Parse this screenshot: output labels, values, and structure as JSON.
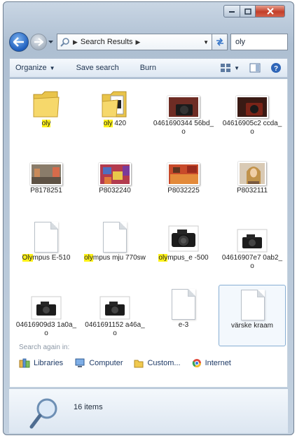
{
  "window": {
    "address_crumb": "Search Results",
    "search_query": "oly",
    "accent": "#2a6fd0"
  },
  "toolbar": {
    "organize": "Organize",
    "save_search": "Save search",
    "burn": "Burn"
  },
  "items": [
    {
      "id": "oly",
      "kind": "folder",
      "label_parts": [
        {
          "t": "oly",
          "h": true
        }
      ]
    },
    {
      "id": "oly420",
      "kind": "folder-photo",
      "label_parts": [
        {
          "t": "oly",
          "h": true
        },
        {
          "t": " 420",
          "h": false
        }
      ]
    },
    {
      "id": "p1",
      "kind": "photo-camera-dark",
      "label_parts": [
        {
          "t": "0461690344 56bd_o",
          "h": false
        }
      ]
    },
    {
      "id": "p2",
      "kind": "photo-camera-red",
      "label_parts": [
        {
          "t": "04616905c2 ccda_o",
          "h": false
        }
      ]
    },
    {
      "id": "p3",
      "kind": "photo-street",
      "label_parts": [
        {
          "t": "P8178251",
          "h": false
        }
      ]
    },
    {
      "id": "p4",
      "kind": "photo-fabric",
      "label_parts": [
        {
          "t": "P8032240",
          "h": false
        }
      ]
    },
    {
      "id": "p5",
      "kind": "photo-market",
      "label_parts": [
        {
          "t": "P8032225",
          "h": false
        }
      ]
    },
    {
      "id": "p6",
      "kind": "photo-woman",
      "label_parts": [
        {
          "t": "P8032111",
          "h": false
        }
      ]
    },
    {
      "id": "d1",
      "kind": "document",
      "label_parts": [
        {
          "t": "Oly",
          "h": true
        },
        {
          "t": "mpus E-510",
          "h": false
        }
      ]
    },
    {
      "id": "d2",
      "kind": "document",
      "label_parts": [
        {
          "t": "oly",
          "h": true
        },
        {
          "t": "mpus mju 770sw",
          "h": false
        }
      ]
    },
    {
      "id": "c1",
      "kind": "camera-big",
      "label_parts": [
        {
          "t": "oly",
          "h": true
        },
        {
          "t": "mpus_e -500",
          "h": false
        }
      ]
    },
    {
      "id": "c2",
      "kind": "camera-small",
      "label_parts": [
        {
          "t": "04616907e7 0ab2_o",
          "h": false
        }
      ]
    },
    {
      "id": "c3",
      "kind": "camera-small",
      "label_parts": [
        {
          "t": "04616909d3 1a0a_o",
          "h": false
        }
      ]
    },
    {
      "id": "c4",
      "kind": "camera-small",
      "label_parts": [
        {
          "t": "0461691152 a46a_o",
          "h": false
        }
      ]
    },
    {
      "id": "d3",
      "kind": "document",
      "label_parts": [
        {
          "t": "e-3",
          "h": false
        }
      ]
    },
    {
      "id": "d4",
      "kind": "document",
      "selected": true,
      "label_parts": [
        {
          "t": "värske kraam",
          "h": false
        }
      ]
    }
  ],
  "search_again": {
    "title": "Search again in:",
    "links": [
      "Libraries",
      "Computer",
      "Custom...",
      "Internet"
    ]
  },
  "details": {
    "count_text": "16 items"
  }
}
